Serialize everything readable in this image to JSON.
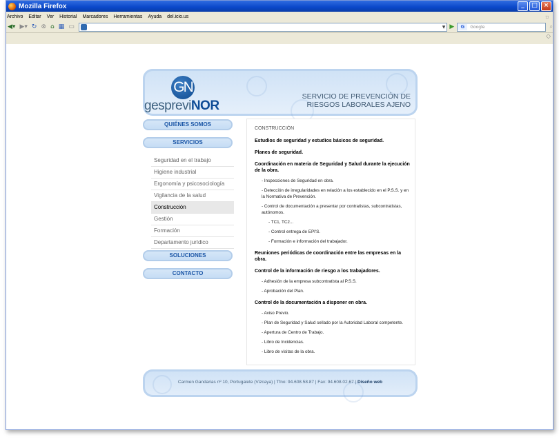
{
  "browser": {
    "title": "Mozilla Firefox",
    "menu": [
      "Archivo",
      "Editar",
      "Ver",
      "Historial",
      "Marcadores",
      "Herramientas",
      "Ayuda",
      "del.icio.us"
    ],
    "search_placeholder": "Google",
    "search_engine_letter": "G"
  },
  "site": {
    "logo_mark": "GN",
    "logo_prefix": "gesprevi",
    "logo_suffix": "NOR",
    "header_line1": "SERVICIO DE PREVENCIÓN DE",
    "header_line2": "RIESGOS LABORALES AJENO",
    "menu_top": [
      "QUIÉNES SOMOS",
      "SERVICIOS"
    ],
    "submenu": [
      {
        "label": "Seguridad en el trabajo",
        "active": false
      },
      {
        "label": "Higiene industrial",
        "active": false
      },
      {
        "label": "Ergonomía y psicosociología",
        "active": false
      },
      {
        "label": "Vigilancia de la salud",
        "active": false
      },
      {
        "label": "Construcción",
        "active": true
      },
      {
        "label": "Gestión",
        "active": false
      },
      {
        "label": "Formación",
        "active": false
      },
      {
        "label": "Departamento jurídico",
        "active": false
      }
    ],
    "menu_bottom": [
      "SOLUCIONES",
      "CONTACTO"
    ],
    "content": {
      "section_title": "CONSTRUCCIÓN",
      "blocks": [
        {
          "heading": "Estudios de seguridad y estudios básicos de seguridad.",
          "items": []
        },
        {
          "heading": "Planes de seguridad.",
          "items": []
        },
        {
          "heading": "Coordinación en materia de Seguridad y Salud durante la ejecución de la obra.",
          "items": [
            {
              "text": "- Inspecciones de Seguridad en obra.",
              "level": 1
            },
            {
              "text": "- Detección de irregularidades en relación a los establecido en el P.S.S. y en la Normativa de Prevención.",
              "level": 1
            },
            {
              "text": "- Control de documentación a presentar por contratistas, subcontratistas, autónomos.",
              "level": 1
            },
            {
              "text": "- TC1, TC2...",
              "level": 2
            },
            {
              "text": "- Control entrega de EPI'S.",
              "level": 2
            },
            {
              "text": "- Formación e información del trabajador.",
              "level": 2
            }
          ]
        },
        {
          "heading": "Reuniones periódicas de coordinación entre las empresas en la obra.",
          "items": []
        },
        {
          "heading": "Control de la información de riesgo a los trabajadores.",
          "items": [
            {
              "text": "- Adhesión de la empresa subcontratista al P.S.S.",
              "level": 1
            },
            {
              "text": "- Aprobación del Plan.",
              "level": 1
            }
          ]
        },
        {
          "heading": "Control de la documentación a disponer en obra.",
          "items": [
            {
              "text": "- Aviso Previo.",
              "level": 1
            },
            {
              "text": "- Plan de Seguridad y Salud sellado por la Autoridad Laboral competente.",
              "level": 1
            },
            {
              "text": "- Apertura de Centro de Trabajo.",
              "level": 1
            },
            {
              "text": "- Libro de Incidencias.",
              "level": 1
            },
            {
              "text": "- Libro de visitas de la obra.",
              "level": 1
            }
          ]
        }
      ]
    },
    "footer_text": "Carmen Gandarias nº 10, Portugalete (Vizcaya) | Tfno: 94.608.58.87 | Fax: 94.608.02.67 | ",
    "footer_link": "Diseño web"
  }
}
